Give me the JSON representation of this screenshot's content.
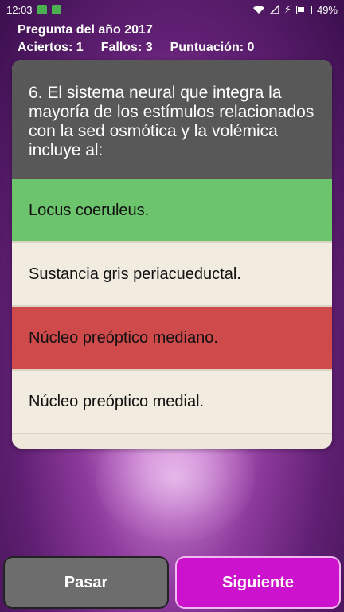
{
  "status": {
    "time": "12:03",
    "battery": "49%"
  },
  "header": {
    "title": "Pregunta del año 2017",
    "aciertos": "Aciertos: 1",
    "fallos": "Fallos: 3",
    "puntuacion": "Puntuación: 0"
  },
  "question": {
    "text": "6. El sistema neural que integra la mayoría de los estímulos relacionados con la sed osmótica y la volémica incluye al:"
  },
  "options": [
    {
      "label": "Locus coeruleus.",
      "state": "correct"
    },
    {
      "label": "Sustancia gris periacueductal.",
      "state": "neutral"
    },
    {
      "label": "Núcleo preóptico mediano.",
      "state": "wrong"
    },
    {
      "label": "Núcleo preóptico medial.",
      "state": "neutral"
    }
  ],
  "buttons": {
    "skip": "Pasar",
    "next": "Siguiente"
  },
  "colors": {
    "correct": "#6cc46c",
    "wrong": "#cf4a4a",
    "accent": "#cc12cc"
  }
}
